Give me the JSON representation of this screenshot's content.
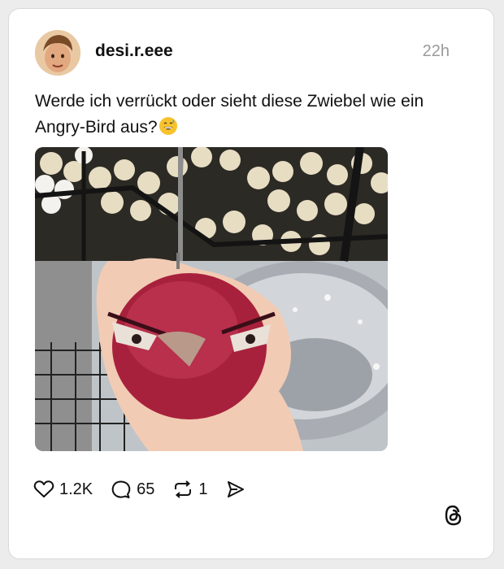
{
  "post": {
    "username": "desi.r.eee",
    "time": "22h",
    "text": "Werde ich verrückt oder sieht diese Zwiebel wie ein Angry-Bird aus?"
  },
  "actions": {
    "likes": "1.2K",
    "replies": "65",
    "reposts": "1"
  },
  "icons": [
    "avatar",
    "heart-icon",
    "comment-icon",
    "repost-icon",
    "share-icon",
    "threads-logo-icon",
    "grinning-sweat-emoji-icon"
  ],
  "colors": {
    "text": "#111111",
    "muted": "#9a9a9a",
    "background": "#ececec"
  }
}
